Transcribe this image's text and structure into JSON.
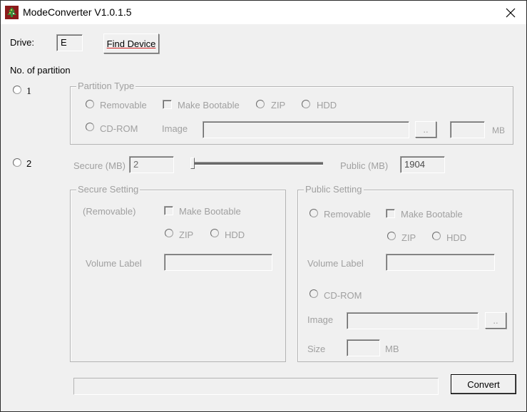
{
  "window": {
    "title": "ModeConverter V1.0.1.5",
    "icon": "app-tree-icon",
    "close_icon": "close-icon"
  },
  "drive": {
    "label": "Drive:",
    "value": "E",
    "find_button": "Find Device"
  },
  "partition_count": {
    "label": "No. of partition",
    "option_1": "1",
    "option_2": "2"
  },
  "partition_type": {
    "title": "Partition Type",
    "removable": "Removable",
    "make_bootable": "Make Bootable",
    "zip": "ZIP",
    "hdd": "HDD",
    "cdrom": "CD-ROM",
    "image_label": "Image",
    "image_value": "",
    "browse": "..",
    "size_value": "",
    "size_unit": "MB"
  },
  "split": {
    "secure_label": "Secure (MB)",
    "secure_value": "2",
    "public_label": "Public (MB)",
    "public_value": "1904",
    "slider_fraction": 0.0
  },
  "secure_setting": {
    "title": "Secure Setting",
    "type_label": "(Removable)",
    "make_bootable": "Make Bootable",
    "zip": "ZIP",
    "hdd": "HDD",
    "volume_label": "Volume Label",
    "volume_value": ""
  },
  "public_setting": {
    "title": "Public Setting",
    "removable": "Removable",
    "make_bootable": "Make Bootable",
    "zip": "ZIP",
    "hdd": "HDD",
    "volume_label": "Volume Label",
    "volume_value": "",
    "cdrom": "CD-ROM",
    "image_label": "Image",
    "image_value": "",
    "browse": "..",
    "size_label": "Size",
    "size_value": "",
    "size_unit": "MB"
  },
  "footer": {
    "progress": 0,
    "convert_button": "Convert"
  }
}
